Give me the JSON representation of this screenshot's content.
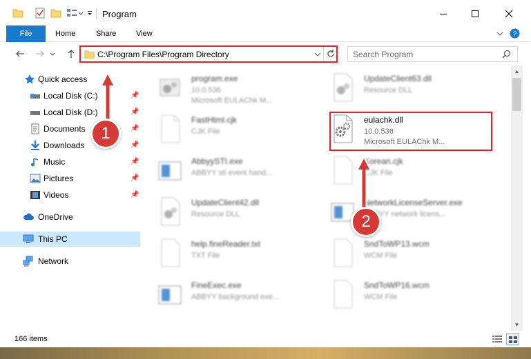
{
  "window": {
    "title": "Program",
    "controls": {
      "minimize": "minimize-icon",
      "maximize": "maximize-icon",
      "close": "close-icon"
    }
  },
  "ribbon": {
    "tabs": [
      {
        "label": "File",
        "active": true
      },
      {
        "label": "Home"
      },
      {
        "label": "Share"
      },
      {
        "label": "View"
      }
    ]
  },
  "address": {
    "path": "C:\\Program Files\\Program Directory"
  },
  "search": {
    "placeholder": "Search Program"
  },
  "sidebar": {
    "items": [
      {
        "label": "Quick access",
        "icon": "star-icon"
      },
      {
        "label": "Local Disk (C:)",
        "icon": "drive-icon",
        "pinned": true
      },
      {
        "label": "Local Disk (D:)",
        "icon": "drive-icon",
        "pinned": true
      },
      {
        "label": "Documents",
        "icon": "documents-icon",
        "pinned": true
      },
      {
        "label": "Downloads",
        "icon": "download-icon",
        "pinned": true
      },
      {
        "label": "Music",
        "icon": "music-icon",
        "pinned": true
      },
      {
        "label": "Pictures",
        "icon": "pictures-icon",
        "pinned": true
      },
      {
        "label": "Videos",
        "icon": "videos-icon",
        "pinned": true
      },
      {
        "label": "OneDrive",
        "icon": "cloud-icon"
      },
      {
        "label": "This PC",
        "icon": "computer-icon",
        "selected": true
      },
      {
        "label": "Network",
        "icon": "network-icon"
      }
    ]
  },
  "files": [
    {
      "name": "program.exe",
      "line1": "10.0.536",
      "line2": "Microsoft EULAChk M...",
      "kind": "exe"
    },
    {
      "name": "UpdateClient63.dll",
      "line1": "Resource DLL",
      "line2": "",
      "kind": "dll"
    },
    {
      "name": "FastHtml.cjk",
      "line1": "CJK File",
      "line2": "",
      "kind": "blank"
    },
    {
      "name": "eulachk.dll",
      "line1": "10.0.536",
      "line2": "Microsoft EULAChk M...",
      "kind": "dll"
    },
    {
      "name": "AbbyySTI.exe",
      "line1": "ABBYY sti event hand...",
      "line2": "",
      "kind": "app"
    },
    {
      "name": "Korean.cjk",
      "line1": "CJK File",
      "line2": "",
      "kind": "blank"
    },
    {
      "name": "UpdateClient42.dll",
      "line1": "Resource DLL",
      "line2": "",
      "kind": "dll"
    },
    {
      "name": "NetworkLicenseServer.exe",
      "line1": "ABBYY network licens...",
      "line2": "",
      "kind": "app"
    },
    {
      "name": "help.fineReader.txt",
      "line1": "TXT File",
      "line2": "",
      "kind": "blank"
    },
    {
      "name": "SndToWP13.wcm",
      "line1": "WCM File",
      "line2": "",
      "kind": "blank"
    },
    {
      "name": "FineExec.exe",
      "line1": "ABBYY background exe...",
      "line2": "",
      "kind": "app"
    },
    {
      "name": "SndToWP16.wcm",
      "line1": "WCM File",
      "line2": "",
      "kind": "blank"
    }
  ],
  "status": {
    "item_count": "166 items"
  },
  "callouts": [
    {
      "label": "1"
    },
    {
      "label": "2"
    }
  ],
  "colors": {
    "accent": "#1979ca",
    "highlight_border": "#e0242d",
    "callout_fill": "#d63a36",
    "selected_bg": "#cce8ff"
  }
}
